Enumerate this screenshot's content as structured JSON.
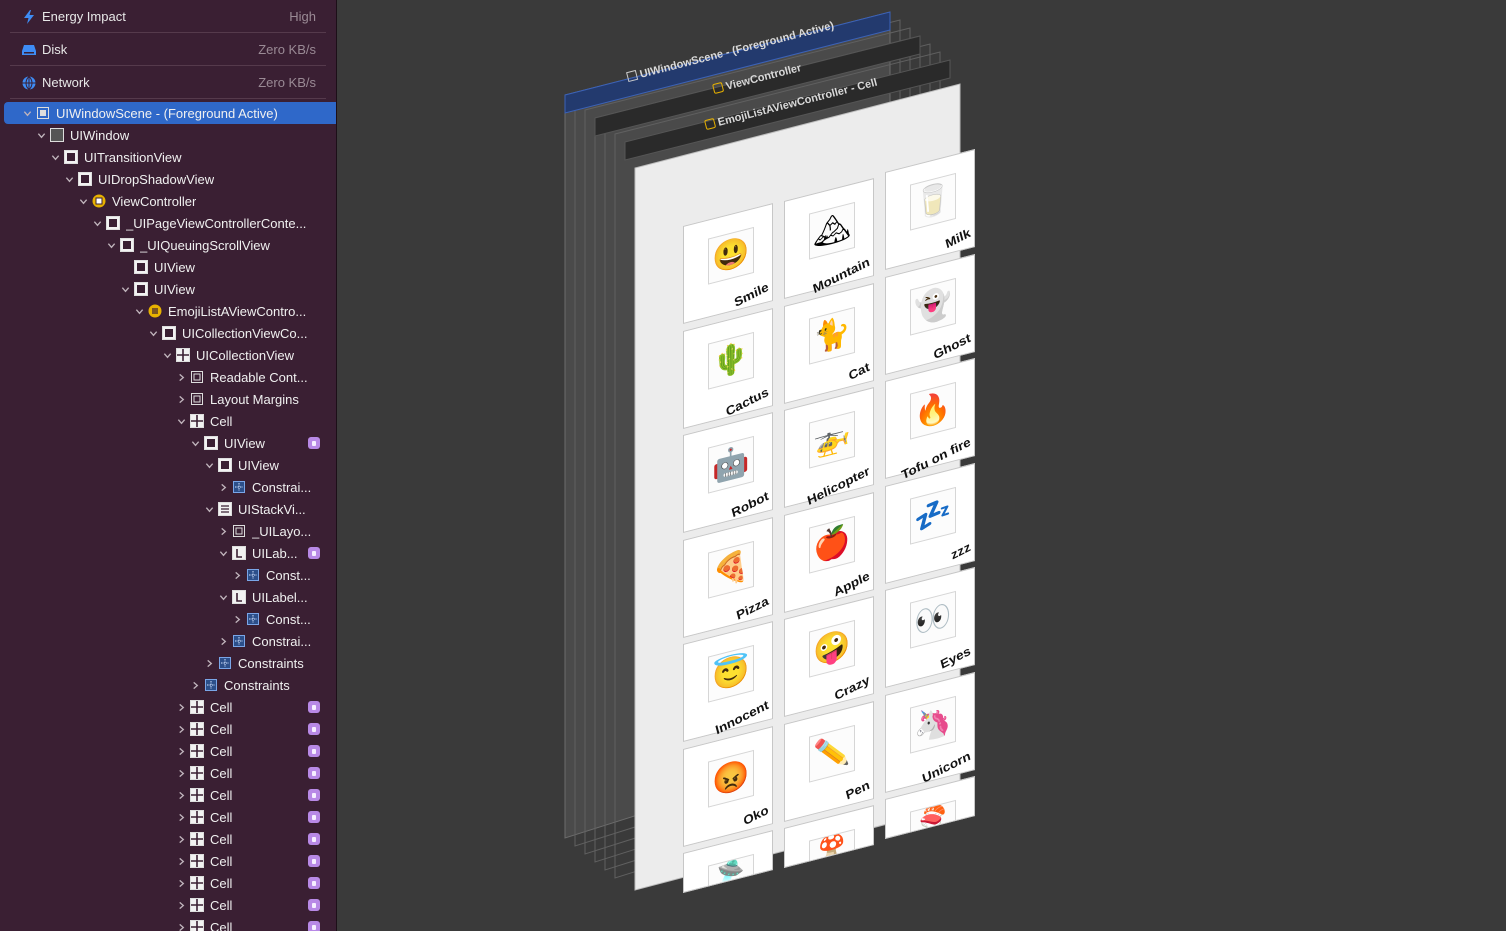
{
  "gauges": [
    {
      "icon": "energy-bolt-icon",
      "label": "Energy Impact",
      "value": "High"
    },
    {
      "icon": "disk-icon",
      "label": "Disk",
      "value": "Zero KB/s"
    },
    {
      "icon": "network-globe-icon",
      "label": "Network",
      "value": "Zero KB/s"
    }
  ],
  "tree": [
    {
      "label": "UIWindowScene - (Foreground Active)",
      "level": 0,
      "chevron": "down",
      "icon": "window-scene-icon",
      "selected": true
    },
    {
      "label": "UIWindow",
      "level": 1,
      "chevron": "down",
      "icon": "window-icon"
    },
    {
      "label": "UITransitionView",
      "level": 2,
      "chevron": "down",
      "icon": "view-icon"
    },
    {
      "label": "UIDropShadowView",
      "level": 3,
      "chevron": "down",
      "icon": "view-icon"
    },
    {
      "label": "ViewController",
      "level": 4,
      "chevron": "down",
      "icon": "view-controller-icon"
    },
    {
      "label": "_UIPageViewControllerConte...",
      "level": 5,
      "chevron": "down",
      "icon": "view-icon"
    },
    {
      "label": "_UIQueuingScrollView",
      "level": 6,
      "chevron": "down",
      "icon": "view-icon"
    },
    {
      "label": "UIView",
      "level": 7,
      "chevron": "none",
      "icon": "view-icon"
    },
    {
      "label": "UIView",
      "level": 7,
      "chevron": "down",
      "icon": "view-icon"
    },
    {
      "label": "EmojiListAViewContro...",
      "level": 8,
      "chevron": "down",
      "icon": "view-controller-grid-icon"
    },
    {
      "label": "UICollectionViewCo...",
      "level": 9,
      "chevron": "down",
      "icon": "view-icon"
    },
    {
      "label": "UICollectionView",
      "level": 10,
      "chevron": "down",
      "icon": "collection-view-icon"
    },
    {
      "label": "Readable Cont...",
      "level": 11,
      "chevron": "right",
      "icon": "layout-guide-icon"
    },
    {
      "label": "Layout Margins",
      "level": 11,
      "chevron": "right",
      "icon": "layout-guide-icon"
    },
    {
      "label": "Cell",
      "level": 11,
      "chevron": "down",
      "icon": "cell-grid-icon"
    },
    {
      "label": "UIView",
      "level": 12,
      "chevron": "down",
      "icon": "view-icon",
      "badge": true
    },
    {
      "label": "UIView",
      "level": 13,
      "chevron": "down",
      "icon": "view-icon"
    },
    {
      "label": "Constrai...",
      "level": 14,
      "chevron": "right",
      "icon": "constraints-icon"
    },
    {
      "label": "UIStackVi...",
      "level": 13,
      "chevron": "down",
      "icon": "stack-view-icon"
    },
    {
      "label": "_UILayo...",
      "level": 14,
      "chevron": "right",
      "icon": "layout-guide-icon"
    },
    {
      "label": "UILab...",
      "level": 14,
      "chevron": "down",
      "icon": "label-icon",
      "badge": true
    },
    {
      "label": "Const...",
      "level": 15,
      "chevron": "right",
      "icon": "constraints-icon"
    },
    {
      "label": "UILabel...",
      "level": 14,
      "chevron": "down",
      "icon": "label-icon"
    },
    {
      "label": "Const...",
      "level": 15,
      "chevron": "right",
      "icon": "constraints-icon"
    },
    {
      "label": "Constrai...",
      "level": 14,
      "chevron": "right",
      "icon": "constraints-icon"
    },
    {
      "label": "Constraints",
      "level": 13,
      "chevron": "right",
      "icon": "constraints-icon"
    },
    {
      "label": "Constraints",
      "level": 12,
      "chevron": "right",
      "icon": "constraints-icon"
    },
    {
      "label": "Cell",
      "level": 11,
      "chevron": "right",
      "icon": "cell-grid-icon",
      "badge": true
    },
    {
      "label": "Cell",
      "level": 11,
      "chevron": "right",
      "icon": "cell-grid-icon",
      "badge": true
    },
    {
      "label": "Cell",
      "level": 11,
      "chevron": "right",
      "icon": "cell-grid-icon",
      "badge": true
    },
    {
      "label": "Cell",
      "level": 11,
      "chevron": "right",
      "icon": "cell-grid-icon",
      "badge": true
    },
    {
      "label": "Cell",
      "level": 11,
      "chevron": "right",
      "icon": "cell-grid-icon",
      "badge": true
    },
    {
      "label": "Cell",
      "level": 11,
      "chevron": "right",
      "icon": "cell-grid-icon",
      "badge": true
    },
    {
      "label": "Cell",
      "level": 11,
      "chevron": "right",
      "icon": "cell-grid-icon",
      "badge": true
    },
    {
      "label": "Cell",
      "level": 11,
      "chevron": "right",
      "icon": "cell-grid-icon",
      "badge": true
    },
    {
      "label": "Cell",
      "level": 11,
      "chevron": "right",
      "icon": "cell-grid-icon",
      "badge": true
    },
    {
      "label": "Cell",
      "level": 11,
      "chevron": "right",
      "icon": "cell-grid-icon",
      "badge": true
    },
    {
      "label": "Cell",
      "level": 11,
      "chevron": "right",
      "icon": "cell-grid-icon",
      "badge": true
    }
  ],
  "layers": {
    "scene_title": "UIWindowScene - (Foreground Active)",
    "vc_title": "ViewController",
    "list_title": "EmojiListAViewController - Cell"
  },
  "cells": [
    {
      "name": "Smile",
      "emoji": "😃"
    },
    {
      "name": "Mountain",
      "emoji": "🏔"
    },
    {
      "name": "Milk",
      "emoji": "🥛"
    },
    {
      "name": "Cactus",
      "emoji": "🌵"
    },
    {
      "name": "Cat",
      "emoji": "🐈"
    },
    {
      "name": "Ghost",
      "emoji": "👻"
    },
    {
      "name": "Robot",
      "emoji": "🤖"
    },
    {
      "name": "Helicopter",
      "emoji": "🚁"
    },
    {
      "name": "Tofu on fire",
      "emoji": "🔥"
    },
    {
      "name": "Pizza",
      "emoji": "🍕"
    },
    {
      "name": "Apple",
      "emoji": "🍎"
    },
    {
      "name": "zzz",
      "emoji": "💤"
    },
    {
      "name": "Innocent",
      "emoji": "😇"
    },
    {
      "name": "Crazy",
      "emoji": "🤪"
    },
    {
      "name": "Eyes",
      "emoji": "👀"
    },
    {
      "name": "Oko",
      "emoji": "😡"
    },
    {
      "name": "Pen",
      "emoji": "✏️"
    },
    {
      "name": "Unicorn",
      "emoji": "🦄"
    }
  ],
  "partial_cells": [
    {
      "emoji": "🛸"
    },
    {
      "emoji": "🍄"
    },
    {
      "emoji": "🍣"
    }
  ],
  "colors": {
    "sidebar_bg": "#3a1f33",
    "selection": "#2f68c9",
    "canvas_bg": "#3a3a3a",
    "badge": "#b889e6",
    "gauge_icon": "#3e8cf5"
  }
}
